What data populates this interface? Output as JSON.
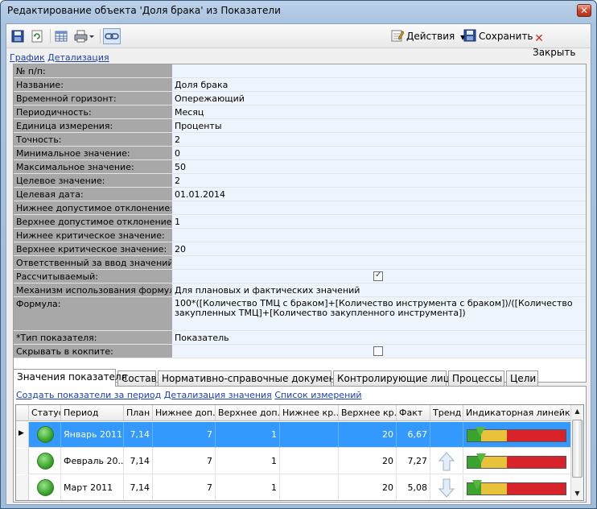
{
  "window": {
    "title": "Редактирование объекта 'Доля брака' из Показатели"
  },
  "toolbar": {
    "actions_label": "Действия",
    "save_label": "Сохранить",
    "close_label": "Закрыть"
  },
  "top_links": {
    "chart": "График",
    "detail": "Детализация"
  },
  "properties": [
    {
      "label": "№ п/п:",
      "value": ""
    },
    {
      "label": "Название:",
      "value": "Доля брака"
    },
    {
      "label": "Временной горизонт:",
      "value": "Опережающий"
    },
    {
      "label": "Периодичность:",
      "value": "Месяц"
    },
    {
      "label": "Единица измерения:",
      "value": "Проценты"
    },
    {
      "label": "Точность:",
      "value": "2"
    },
    {
      "label": "Минимальное значение:",
      "value": "0"
    },
    {
      "label": "Максимальное значение:",
      "value": "50"
    },
    {
      "label": "Целевое значение:",
      "value": "2"
    },
    {
      "label": "Целевая дата:",
      "value": "01.01.2014"
    },
    {
      "label": "Нижнее допустимое отклонение:",
      "value": ""
    },
    {
      "label": "Верхнее допустимое отклонение:",
      "value": "1"
    },
    {
      "label": "Нижнее критическое значение:",
      "value": ""
    },
    {
      "label": "Верхнее критическое значение:",
      "value": "20"
    },
    {
      "label": "Ответственный за ввод значений:",
      "value": ""
    },
    {
      "label": "Рассчитываемый:",
      "value": "",
      "checked": true
    },
    {
      "label": "Механизм использования формулы:",
      "value": "Для плановых и фактических значений"
    },
    {
      "label": "Формула:",
      "value": "100*([Количество ТМЦ с браком]+[Количество инструмента с браком])/([Количество закупленных ТМЦ]+[Количество закупленного инструмента])"
    },
    {
      "label": "*Тип показателя:",
      "value": "Показатель"
    },
    {
      "label": "Скрывать в кокпите:",
      "value": "",
      "checked": false
    }
  ],
  "tabs": [
    "Значения показателя",
    "Состав",
    "Нормативно-справочные документы",
    "Контролирующие лица",
    "Процессы",
    "Цели"
  ],
  "sub_links": {
    "create": "Создать показатели за период",
    "detail": "Детализация значения",
    "list": "Список измерений"
  },
  "grid": {
    "columns": [
      "Статус",
      "Период",
      "План",
      "Нижнее доп...",
      "Верхнее доп...",
      "Нижнее кр...",
      "Верхнее кр...",
      "Факт",
      "Тренд",
      "Индикаторная линейка"
    ],
    "rows": [
      {
        "status": "green",
        "period": "Январь 2011",
        "plan": "7,14",
        "lower_dev": "7",
        "upper_dev": "1",
        "lower_crit": "",
        "upper_crit": "20",
        "fact": "6,67",
        "trend": "",
        "indicator": 0.13,
        "selected": true
      },
      {
        "status": "green",
        "period": "Февраль 20...",
        "plan": "7,14",
        "lower_dev": "7",
        "upper_dev": "1",
        "lower_crit": "",
        "upper_crit": "20",
        "fact": "7,27",
        "trend": "up",
        "indicator": 0.14
      },
      {
        "status": "green",
        "period": "Март 2011",
        "plan": "7,14",
        "lower_dev": "7",
        "upper_dev": "1",
        "lower_crit": "",
        "upper_crit": "20",
        "fact": "5,08",
        "trend": "down",
        "indicator": 0.1
      }
    ]
  },
  "colors": {
    "selection": "#3399ff",
    "label_bg": "#a8a8a8",
    "value_bg": "#eef4fb",
    "status_green": "#3aa52c",
    "link": "#1a3fb5"
  }
}
